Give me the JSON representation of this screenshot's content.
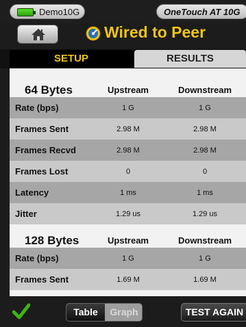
{
  "statusbar": {
    "profile_name": "Demo10G",
    "device_name": "OneTouch AT 10G",
    "battery_color": "#3cc417"
  },
  "header": {
    "home_icon": "home-icon",
    "title_icon": "gauge-icon",
    "title": "Wired to Peer",
    "title_color": "#f0c419"
  },
  "tabs": [
    {
      "label": "SETUP",
      "active": true
    },
    {
      "label": "RESULTS",
      "active": false
    }
  ],
  "sections": [
    {
      "title": "64 Bytes",
      "columns": [
        "Upstream",
        "Downstream"
      ],
      "rows": [
        {
          "label": "Rate (bps)",
          "up": "1 G",
          "down": "1 G"
        },
        {
          "label": "Frames Sent",
          "up": "2.98 M",
          "down": "2.98 M"
        },
        {
          "label": "Frames Recvd",
          "up": "2.98 M",
          "down": "2.98 M"
        },
        {
          "label": "Frames Lost",
          "up": "0",
          "down": "0"
        },
        {
          "label": "Latency",
          "up": "1 ms",
          "down": "1 ms"
        },
        {
          "label": "Jitter",
          "up": "1.29 us",
          "down": "1.29 us"
        }
      ]
    },
    {
      "title": "128 Bytes",
      "columns": [
        "Upstream",
        "Downstream"
      ],
      "rows": [
        {
          "label": "Rate (bps)",
          "up": "1 G",
          "down": "1 G"
        },
        {
          "label": "Frames Sent",
          "up": "1.69 M",
          "down": "1.69 M"
        }
      ]
    }
  ],
  "bottombar": {
    "status_icon": "checkmark-icon",
    "view_options": [
      "Table",
      "Graph"
    ],
    "selected_view": "Table",
    "test_again_label": "TEST AGAIN"
  }
}
